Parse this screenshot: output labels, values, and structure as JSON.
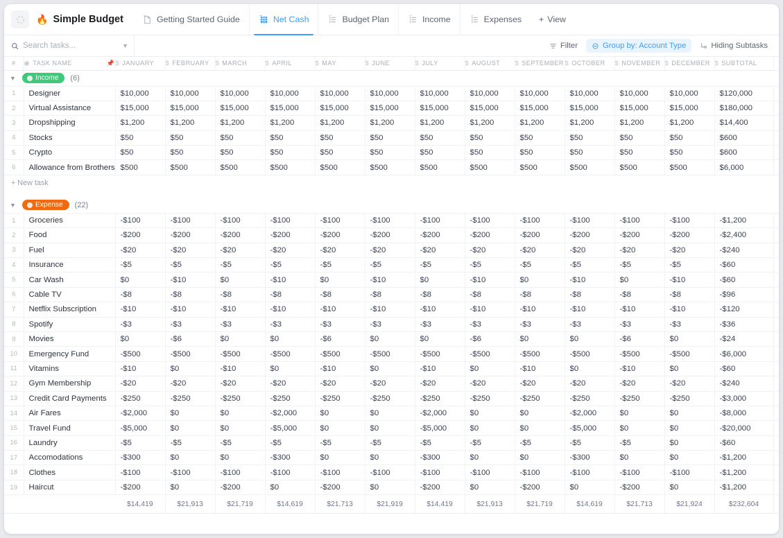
{
  "window": {
    "doc_title": "Simple Budget",
    "doc_emoji": "🔥"
  },
  "tabs": [
    {
      "label": "Getting Started Guide",
      "icon": "doc-icon",
      "active": false
    },
    {
      "label": "Net Cash",
      "icon": "table-icon",
      "active": true
    },
    {
      "label": "Budget Plan",
      "icon": "list-icon",
      "active": false
    },
    {
      "label": "Income",
      "icon": "list-icon",
      "active": false
    },
    {
      "label": "Expenses",
      "icon": "list-icon",
      "active": false
    }
  ],
  "add_view_label": "View",
  "toolbar": {
    "search_placeholder": "Search tasks...",
    "search_value": "",
    "filter_label": "Filter",
    "group_by_label": "Group by: Account Type",
    "hiding_subtasks_label": "Hiding Subtasks",
    "accent_color": "#3d9ff5"
  },
  "columns": {
    "index_label": "#",
    "task_name_label": "TASK NAME",
    "months": [
      "JANUARY",
      "FEBRUARY",
      "MARCH",
      "APRIL",
      "MAY",
      "JUNE",
      "JULY",
      "AUGUST",
      "SEPTEMBER",
      "OCTOBER",
      "NOVEMBER",
      "DECEMBER"
    ],
    "subtotal_label": "SUBTOTAL"
  },
  "new_task_label": "+ New task",
  "groups": [
    {
      "name": "Income",
      "count": "(6)",
      "color": "#3fc97a",
      "rows": [
        {
          "n": "1",
          "name": "Designer",
          "v": [
            "$10,000",
            "$10,000",
            "$10,000",
            "$10,000",
            "$10,000",
            "$10,000",
            "$10,000",
            "$10,000",
            "$10,000",
            "$10,000",
            "$10,000",
            "$10,000"
          ],
          "sub": "$120,000"
        },
        {
          "n": "2",
          "name": "Virtual Assistance",
          "v": [
            "$15,000",
            "$15,000",
            "$15,000",
            "$15,000",
            "$15,000",
            "$15,000",
            "$15,000",
            "$15,000",
            "$15,000",
            "$15,000",
            "$15,000",
            "$15,000"
          ],
          "sub": "$180,000"
        },
        {
          "n": "3",
          "name": "Dropshipping",
          "v": [
            "$1,200",
            "$1,200",
            "$1,200",
            "$1,200",
            "$1,200",
            "$1,200",
            "$1,200",
            "$1,200",
            "$1,200",
            "$1,200",
            "$1,200",
            "$1,200"
          ],
          "sub": "$14,400"
        },
        {
          "n": "4",
          "name": "Stocks",
          "v": [
            "$50",
            "$50",
            "$50",
            "$50",
            "$50",
            "$50",
            "$50",
            "$50",
            "$50",
            "$50",
            "$50",
            "$50"
          ],
          "sub": "$600"
        },
        {
          "n": "5",
          "name": "Crypto",
          "v": [
            "$50",
            "$50",
            "$50",
            "$50",
            "$50",
            "$50",
            "$50",
            "$50",
            "$50",
            "$50",
            "$50",
            "$50"
          ],
          "sub": "$600"
        },
        {
          "n": "6",
          "name": "Allowance from Brothers",
          "v": [
            "$500",
            "$500",
            "$500",
            "$500",
            "$500",
            "$500",
            "$500",
            "$500",
            "$500",
            "$500",
            "$500",
            "$500"
          ],
          "sub": "$6,000"
        }
      ]
    },
    {
      "name": "Expense",
      "count": "(22)",
      "color": "#f06a12",
      "rows": [
        {
          "n": "1",
          "name": "Groceries",
          "v": [
            "-$100",
            "-$100",
            "-$100",
            "-$100",
            "-$100",
            "-$100",
            "-$100",
            "-$100",
            "-$100",
            "-$100",
            "-$100",
            "-$100"
          ],
          "sub": "-$1,200"
        },
        {
          "n": "2",
          "name": "Food",
          "v": [
            "-$200",
            "-$200",
            "-$200",
            "-$200",
            "-$200",
            "-$200",
            "-$200",
            "-$200",
            "-$200",
            "-$200",
            "-$200",
            "-$200"
          ],
          "sub": "-$2,400"
        },
        {
          "n": "3",
          "name": "Fuel",
          "v": [
            "-$20",
            "-$20",
            "-$20",
            "-$20",
            "-$20",
            "-$20",
            "-$20",
            "-$20",
            "-$20",
            "-$20",
            "-$20",
            "-$20"
          ],
          "sub": "-$240"
        },
        {
          "n": "4",
          "name": "Insurance",
          "v": [
            "-$5",
            "-$5",
            "-$5",
            "-$5",
            "-$5",
            "-$5",
            "-$5",
            "-$5",
            "-$5",
            "-$5",
            "-$5",
            "-$5"
          ],
          "sub": "-$60"
        },
        {
          "n": "5",
          "name": "Car Wash",
          "v": [
            "$0",
            "-$10",
            "$0",
            "-$10",
            "$0",
            "-$10",
            "$0",
            "-$10",
            "$0",
            "-$10",
            "$0",
            "-$10"
          ],
          "sub": "-$60"
        },
        {
          "n": "6",
          "name": "Cable TV",
          "v": [
            "-$8",
            "-$8",
            "-$8",
            "-$8",
            "-$8",
            "-$8",
            "-$8",
            "-$8",
            "-$8",
            "-$8",
            "-$8",
            "-$8"
          ],
          "sub": "-$96"
        },
        {
          "n": "7",
          "name": "Netflix Subscription",
          "v": [
            "-$10",
            "-$10",
            "-$10",
            "-$10",
            "-$10",
            "-$10",
            "-$10",
            "-$10",
            "-$10",
            "-$10",
            "-$10",
            "-$10"
          ],
          "sub": "-$120"
        },
        {
          "n": "8",
          "name": "Spotify",
          "v": [
            "-$3",
            "-$3",
            "-$3",
            "-$3",
            "-$3",
            "-$3",
            "-$3",
            "-$3",
            "-$3",
            "-$3",
            "-$3",
            "-$3"
          ],
          "sub": "-$36"
        },
        {
          "n": "9",
          "name": "Movies",
          "v": [
            "$0",
            "-$6",
            "$0",
            "$0",
            "-$6",
            "$0",
            "$0",
            "-$6",
            "$0",
            "$0",
            "-$6",
            "$0"
          ],
          "sub": "-$24"
        },
        {
          "n": "10",
          "name": "Emergency Fund",
          "v": [
            "-$500",
            "-$500",
            "-$500",
            "-$500",
            "-$500",
            "-$500",
            "-$500",
            "-$500",
            "-$500",
            "-$500",
            "-$500",
            "-$500"
          ],
          "sub": "-$6,000"
        },
        {
          "n": "11",
          "name": "Vitamins",
          "v": [
            "-$10",
            "$0",
            "-$10",
            "$0",
            "-$10",
            "$0",
            "-$10",
            "$0",
            "-$10",
            "$0",
            "-$10",
            "$0"
          ],
          "sub": "-$60"
        },
        {
          "n": "12",
          "name": "Gym Membership",
          "v": [
            "-$20",
            "-$20",
            "-$20",
            "-$20",
            "-$20",
            "-$20",
            "-$20",
            "-$20",
            "-$20",
            "-$20",
            "-$20",
            "-$20"
          ],
          "sub": "-$240"
        },
        {
          "n": "13",
          "name": "Credit Card Payments",
          "v": [
            "-$250",
            "-$250",
            "-$250",
            "-$250",
            "-$250",
            "-$250",
            "-$250",
            "-$250",
            "-$250",
            "-$250",
            "-$250",
            "-$250"
          ],
          "sub": "-$3,000"
        },
        {
          "n": "14",
          "name": "Air Fares",
          "v": [
            "-$2,000",
            "$0",
            "$0",
            "-$2,000",
            "$0",
            "$0",
            "-$2,000",
            "$0",
            "$0",
            "-$2,000",
            "$0",
            "$0"
          ],
          "sub": "-$8,000"
        },
        {
          "n": "15",
          "name": "Travel Fund",
          "v": [
            "-$5,000",
            "$0",
            "$0",
            "-$5,000",
            "$0",
            "$0",
            "-$5,000",
            "$0",
            "$0",
            "-$5,000",
            "$0",
            "$0"
          ],
          "sub": "-$20,000"
        },
        {
          "n": "16",
          "name": "Laundry",
          "v": [
            "-$5",
            "-$5",
            "-$5",
            "-$5",
            "-$5",
            "-$5",
            "-$5",
            "-$5",
            "-$5",
            "-$5",
            "-$5",
            "$0"
          ],
          "sub": "-$60"
        },
        {
          "n": "17",
          "name": "Accomodations",
          "v": [
            "-$300",
            "$0",
            "$0",
            "-$300",
            "$0",
            "$0",
            "-$300",
            "$0",
            "$0",
            "-$300",
            "$0",
            "$0"
          ],
          "sub": "-$1,200"
        },
        {
          "n": "18",
          "name": "Clothes",
          "v": [
            "-$100",
            "-$100",
            "-$100",
            "-$100",
            "-$100",
            "-$100",
            "-$100",
            "-$100",
            "-$100",
            "-$100",
            "-$100",
            "-$100"
          ],
          "sub": "-$1,200"
        },
        {
          "n": "19",
          "name": "Haircut",
          "v": [
            "-$200",
            "$0",
            "-$200",
            "$0",
            "-$200",
            "$0",
            "-$200",
            "$0",
            "-$200",
            "$0",
            "-$200",
            "$0"
          ],
          "sub": "-$1,200"
        }
      ]
    }
  ],
  "totals": {
    "values": [
      "$14,419",
      "$21,913",
      "$21,719",
      "$14,619",
      "$21,713",
      "$21,919",
      "$14,419",
      "$21,913",
      "$21,719",
      "$14,619",
      "$21,713",
      "$21,924"
    ],
    "subtotal": "$232,604"
  }
}
